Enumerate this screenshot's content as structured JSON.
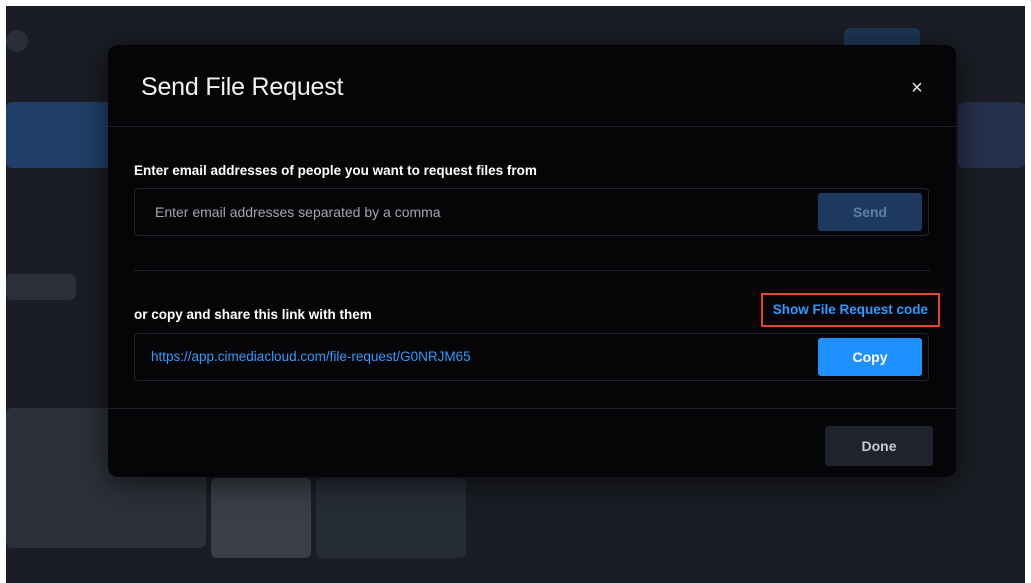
{
  "modal": {
    "title": "Send File Request",
    "close_icon": "×"
  },
  "email_section": {
    "label": "Enter email addresses of people you want to request files from",
    "placeholder": "Enter email addresses separated by a comma",
    "send_label": "Send"
  },
  "link_section": {
    "label": "or copy and share this link with them",
    "show_code_label": "Show File Request code",
    "link": "https://app.cimediacloud.com/file-request/G0NRJM65",
    "copy_label": "Copy"
  },
  "footer": {
    "done_label": "Done"
  },
  "colors": {
    "accent": "#1e90ff",
    "link": "#2f9bff",
    "highlight": "#e5462c",
    "modal_bg": "#050507"
  }
}
